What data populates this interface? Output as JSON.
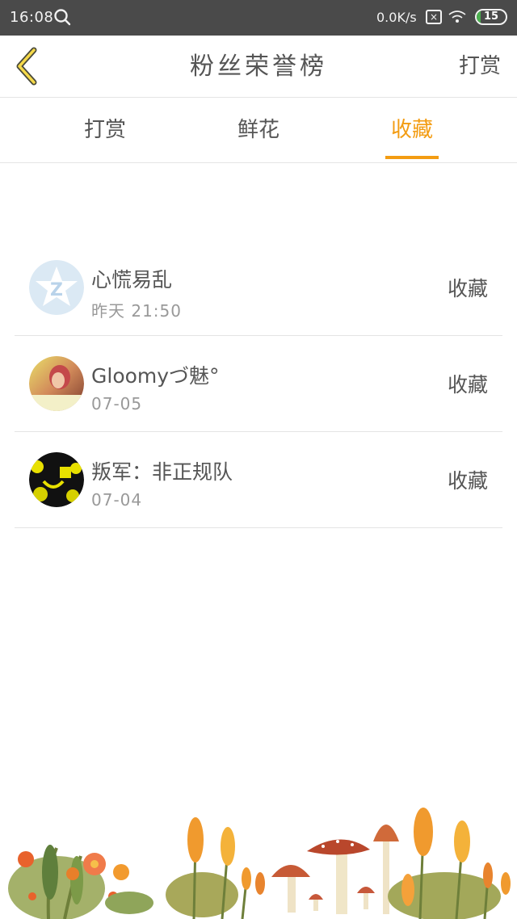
{
  "status_bar": {
    "time": "16:08",
    "speed": "0.0K/s",
    "battery": "15",
    "battery_level": 0.15
  },
  "header": {
    "title": "粉丝荣誉榜",
    "right_action": "打赏"
  },
  "tabs": [
    {
      "label": "打赏",
      "active": false
    },
    {
      "label": "鲜花",
      "active": false
    },
    {
      "label": "收藏",
      "active": true
    }
  ],
  "list": [
    {
      "name": "心慌易乱",
      "date": "昨天 21:50",
      "action": "收藏",
      "avatar": "default-q-avatar"
    },
    {
      "name": "Gloomyづ魅°",
      "date": "07-05",
      "action": "收藏",
      "avatar": "photo-avatar"
    },
    {
      "name": "叛军：非正规队",
      "date": "07-04",
      "action": "收藏",
      "avatar": "dark-yellow-avatar"
    }
  ],
  "colors": {
    "accent": "#f39c12",
    "status_bar_bg": "#4a4a4a",
    "text": "#555555",
    "subtext": "#999999"
  }
}
